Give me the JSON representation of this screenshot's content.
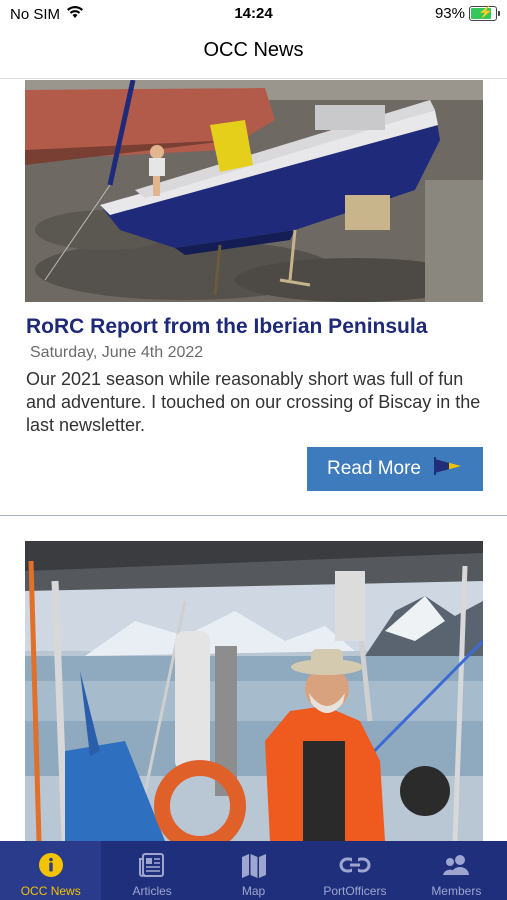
{
  "status_bar": {
    "carrier": "No SIM",
    "time": "14:24",
    "battery_percent": "93%",
    "battery_level": 0.93
  },
  "nav": {
    "title": "OCC News"
  },
  "articles": [
    {
      "title": "RoRC Report from the Iberian Peninsula",
      "date": "Saturday, June 4th 2022",
      "excerpt": "Our 2021 season while reasonably short was full of fun and adventure. I touched on our crossing of Biscay in the last newsletter.",
      "read_more_label": "Read More"
    }
  ],
  "tabs": [
    {
      "label": "OCC News",
      "icon": "info-icon",
      "active": true
    },
    {
      "label": "Articles",
      "icon": "newspaper-icon",
      "active": false
    },
    {
      "label": "Map",
      "icon": "map-icon",
      "active": false
    },
    {
      "label": "PortOfficers",
      "icon": "link-icon",
      "active": false
    },
    {
      "label": "Members",
      "icon": "people-icon",
      "active": false
    }
  ],
  "colors": {
    "tab_bar": "#1f2f7c",
    "tab_active": "#f3c300",
    "title": "#1e2a78",
    "button": "#3d7bbd"
  }
}
